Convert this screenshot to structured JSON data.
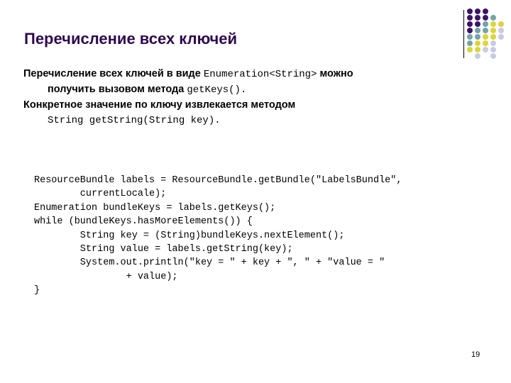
{
  "slide": {
    "title": "Перечисление всех ключей",
    "title_color": "#2d0a4e",
    "background_color": "#ffffff",
    "page_number": "19"
  },
  "body": {
    "line1_part1": "Перечисление всех ключей в виде ",
    "line1_code": "Enumeration<String>",
    "line1_part2": " можно",
    "line2_part1": "получить вызовом метода ",
    "line2_code": "getKeys().",
    "line3_part1": "Конкретное значение по ключу извлекается методом",
    "line4_code": "String getString(String key)."
  },
  "code": {
    "lines": [
      "ResourceBundle labels = ResourceBundle.getBundle(\"LabelsBundle\",",
      "        currentLocale);",
      "Enumeration bundleKeys = labels.getKeys();",
      "while (bundleKeys.hasMoreElements()) {",
      "        String key = (String)bundleKeys.nextElement();",
      "        String value = labels.getString(key);",
      "        System.out.println(\"key = \" + key + \", \" + \"value = \"",
      "                + value);",
      "}"
    ]
  },
  "logo": {
    "rows": [
      [
        {
          "c": "#3c1466",
          "x": 0,
          "y": 0
        },
        {
          "c": "#3c1466",
          "x": 11,
          "y": 0
        },
        {
          "c": "#3c1466",
          "x": 22,
          "y": 0
        }
      ],
      [
        {
          "c": "#3c1466",
          "x": 0,
          "y": 9
        },
        {
          "c": "#3c1466",
          "x": 11,
          "y": 9
        },
        {
          "c": "#3c1466",
          "x": 22,
          "y": 9
        },
        {
          "c": "#74a3a8",
          "x": 33,
          "y": 9
        }
      ],
      [
        {
          "c": "#3c1466",
          "x": 0,
          "y": 18
        },
        {
          "c": "#3c1466",
          "x": 11,
          "y": 18
        },
        {
          "c": "#74a3a8",
          "x": 22,
          "y": 18
        },
        {
          "c": "#dcd43c",
          "x": 33,
          "y": 18
        },
        {
          "c": "#dcd43c",
          "x": 44,
          "y": 18
        }
      ],
      [
        {
          "c": "#3c1466",
          "x": 0,
          "y": 27
        },
        {
          "c": "#74a3a8",
          "x": 11,
          "y": 27
        },
        {
          "c": "#74a3a8",
          "x": 22,
          "y": 27
        },
        {
          "c": "#dcd43c",
          "x": 33,
          "y": 27
        },
        {
          "c": "#c9cbe3",
          "x": 44,
          "y": 27
        }
      ],
      [
        {
          "c": "#74a3a8",
          "x": 0,
          "y": 36
        },
        {
          "c": "#74a3a8",
          "x": 11,
          "y": 36
        },
        {
          "c": "#dcd43c",
          "x": 22,
          "y": 36
        },
        {
          "c": "#dcd43c",
          "x": 33,
          "y": 36
        },
        {
          "c": "#c9cbe3",
          "x": 44,
          "y": 36
        }
      ],
      [
        {
          "c": "#74a3a8",
          "x": 0,
          "y": 45
        },
        {
          "c": "#dcd43c",
          "x": 11,
          "y": 45
        },
        {
          "c": "#dcd43c",
          "x": 22,
          "y": 45
        },
        {
          "c": "#c9cbe3",
          "x": 33,
          "y": 45
        }
      ],
      [
        {
          "c": "#dcd43c",
          "x": 0,
          "y": 54
        },
        {
          "c": "#dcd43c",
          "x": 11,
          "y": 54
        },
        {
          "c": "#c9cbe3",
          "x": 22,
          "y": 54
        },
        {
          "c": "#c9cbe3",
          "x": 33,
          "y": 54
        }
      ],
      [
        {
          "c": "#c9cbe3",
          "x": 11,
          "y": 63
        },
        {
          "c": "#c9cbe3",
          "x": 33,
          "y": 63
        }
      ]
    ]
  }
}
